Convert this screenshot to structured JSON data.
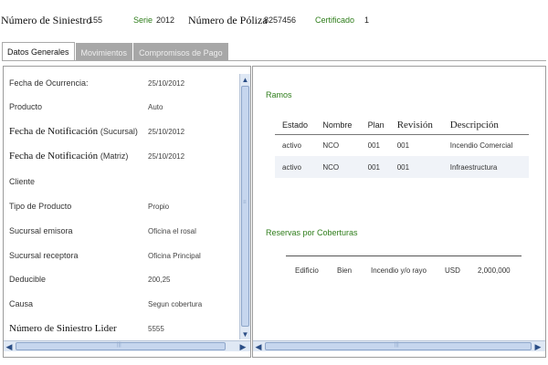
{
  "header": {
    "siniestro_label": "Número de Siniestro",
    "siniestro_value": "155",
    "serie_label": "Serie",
    "serie_value": "2012",
    "poliza_label": "Número de Póliza",
    "poliza_value": "8257456",
    "certificado_label": "Certificado",
    "certificado_value": "1"
  },
  "tabs": [
    {
      "label": "Datos Generales",
      "active": true
    },
    {
      "label": "Movimientos",
      "active": false
    },
    {
      "label": "Compromisos de Pago",
      "active": false
    }
  ],
  "general": {
    "fields": [
      {
        "label": "Fecha de Ocurrencia:",
        "value": "25/10/2012"
      },
      {
        "label": "Producto",
        "value": "Auto"
      },
      {
        "label": "Fecha de Notificación",
        "label_suffix": "(Sucursal)",
        "value": "25/10/2012"
      },
      {
        "label": "Fecha de Notificación",
        "label_suffix": "(Matriz)",
        "value": "25/10/2012"
      },
      {
        "label": "Cliente",
        "value": ""
      },
      {
        "label": "Tipo de Producto",
        "value": "Propio"
      },
      {
        "label": "Sucursal emisora",
        "value": "Oficina el rosal"
      },
      {
        "label": "Sucursal receptora",
        "value": "Oficina Principal"
      },
      {
        "label": "Deducible",
        "value": "200,25"
      },
      {
        "label": "Causa",
        "value": "Segun cobertura"
      },
      {
        "label": "Número de Siniestro Lider",
        "value": "5555"
      }
    ]
  },
  "ramos": {
    "title": "Ramos",
    "columns": [
      "Estado",
      "Nombre",
      "Plan",
      "Revisión",
      "Descripción"
    ],
    "rows": [
      [
        "activo",
        "NCO",
        "001",
        "001",
        "Incendio Comercial"
      ],
      [
        "activo",
        "NCO",
        "001",
        "001",
        "Infraestructura"
      ]
    ]
  },
  "reservas": {
    "title": "Reservas por Coberturas",
    "rows": [
      [
        "Edificio",
        "Bien",
        "Incendio y/o rayo",
        "USD",
        "2,000,000"
      ]
    ]
  },
  "colors": {
    "accent_green": "#2e7d1a",
    "tab_inactive": "#a7a7a7",
    "scrollbar_track": "#dfe8f4"
  }
}
